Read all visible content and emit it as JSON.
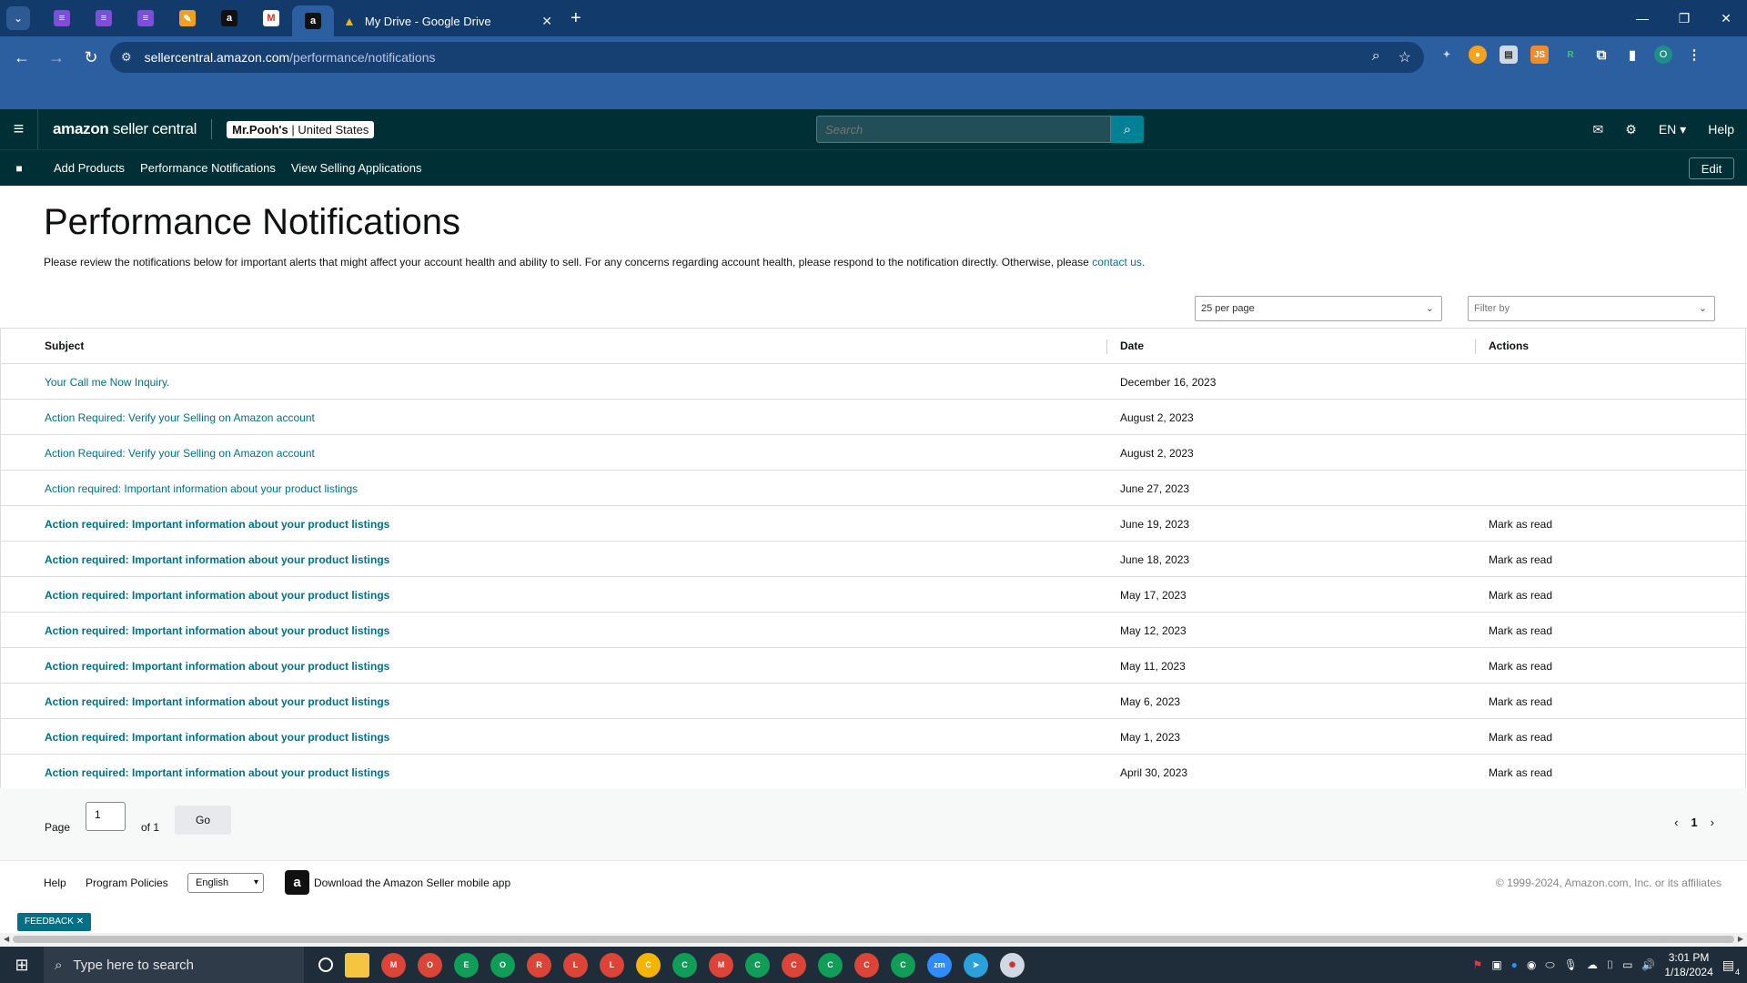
{
  "browser": {
    "active_tab_title": "My Drive - Google Drive",
    "url_domain": "sellercentral.amazon.com",
    "url_path": "/performance/notifications",
    "pinned_tabs": [
      "sheets-icon",
      "sheets-icon",
      "sheets-icon",
      "pen-icon",
      "amazon-icon",
      "gmail-icon",
      "amazon-icon"
    ],
    "profile_initial": "O"
  },
  "header": {
    "logo_brand": "amazon",
    "logo_suffix": " seller central",
    "store_name": "Mr.Pooh's",
    "store_region": " | United States",
    "search_placeholder": "Search",
    "language": "EN",
    "help": "Help"
  },
  "subnav": {
    "links": [
      "Add Products",
      "Performance Notifications",
      "View Selling Applications"
    ],
    "edit": "Edit"
  },
  "page": {
    "title": "Performance Notifications",
    "intro": "Please review the notifications below for important alerts that might affect your account health and ability to sell. For any concerns regarding account health, please respond to the notification directly. Otherwise, please ",
    "intro_link": "contact us.",
    "per_page": "25 per page",
    "filter_placeholder": "Filter by"
  },
  "table": {
    "columns": [
      "Subject",
      "Date",
      "Actions"
    ],
    "rows": [
      {
        "subject": "Your Call me Now Inquiry.",
        "date": "December 16, 2023",
        "action": "",
        "unread": false
      },
      {
        "subject": "Action Required: Verify your Selling on Amazon account",
        "date": "August 2, 2023",
        "action": "",
        "unread": false
      },
      {
        "subject": "Action Required: Verify your Selling on Amazon account",
        "date": "August 2, 2023",
        "action": "",
        "unread": false
      },
      {
        "subject": "Action required: Important information about your product listings",
        "date": "June 27, 2023",
        "action": "",
        "unread": false
      },
      {
        "subject": "Action required: Important information about your product listings",
        "date": "June 19, 2023",
        "action": "Mark as read",
        "unread": true
      },
      {
        "subject": "Action required: Important information about your product listings",
        "date": "June 18, 2023",
        "action": "Mark as read",
        "unread": true
      },
      {
        "subject": "Action required: Important information about your product listings",
        "date": "May 17, 2023",
        "action": "Mark as read",
        "unread": true
      },
      {
        "subject": "Action required: Important information about your product listings",
        "date": "May 12, 2023",
        "action": "Mark as read",
        "unread": true
      },
      {
        "subject": "Action required: Important information about your product listings",
        "date": "May 11, 2023",
        "action": "Mark as read",
        "unread": true
      },
      {
        "subject": "Action required: Important information about your product listings",
        "date": "May 6, 2023",
        "action": "Mark as read",
        "unread": true
      },
      {
        "subject": "Action required: Important information about your product listings",
        "date": "May 1, 2023",
        "action": "Mark as read",
        "unread": true
      },
      {
        "subject": "Action required: Important information about your product listings",
        "date": "April 30, 2023",
        "action": "Mark as read",
        "unread": true
      }
    ]
  },
  "pagination": {
    "page_label": "Page",
    "page_value": "1",
    "of_label": "of 1",
    "go": "Go",
    "current": "1"
  },
  "footer": {
    "help": "Help",
    "policies": "Program Policies",
    "language": "English",
    "app_text": "Download the Amazon Seller mobile app",
    "copyright": "© 1999-2024, Amazon.com, Inc. or its affiliates",
    "feedback": "FEEDBACK"
  },
  "taskbar": {
    "search_placeholder": "Type here to search",
    "time": "3:01 PM",
    "date": "1/18/2024",
    "notification_count": "4"
  },
  "colors": {
    "amazon_header": "#002f36",
    "link": "#007185",
    "browser_frame": "#2c5f9f"
  }
}
